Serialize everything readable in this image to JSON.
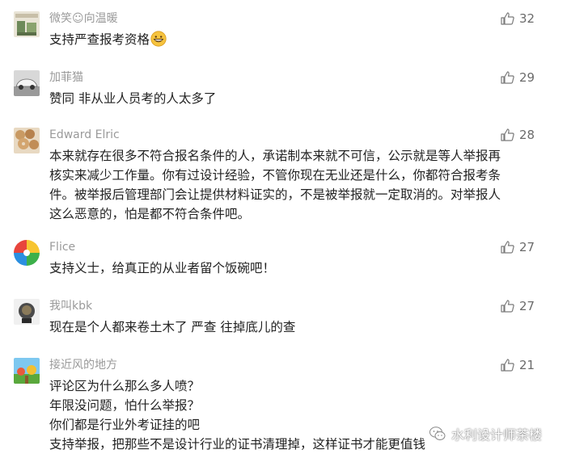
{
  "comments": [
    {
      "username": "微笑☺向温暖",
      "likes": "32",
      "lines": [
        "支持严查报考资格"
      ],
      "emoji": "grinning-face-icon"
    },
    {
      "username": "加菲猫",
      "likes": "29",
      "lines": [
        "赞同 非从业人员考的人太多了"
      ]
    },
    {
      "username": "Edward Elric",
      "likes": "28",
      "lines": [
        "本来就存在很多不符合报名条件的人，承诺制本来就不可信，公示就是等人举报再",
        "核实来减少工作量。你有过设计经验，不管你现在无业还是什么，你都符合报考条",
        "件。被举报后管理部门会让提供材料证实的，不是被举报就一定取消的。对举报人",
        "这么恶意的，怕是都不符合条件吧。"
      ]
    },
    {
      "username": "Flice",
      "likes": "27",
      "lines": [
        "支持义士，给真正的从业者留个饭碗吧！"
      ]
    },
    {
      "username": "我叫kbk",
      "likes": "27",
      "lines": [
        "现在是个人都来卷土木了 严查 往掉底儿的查"
      ]
    },
    {
      "username": "接近风的地方",
      "likes": "21",
      "lines": [
        "评论区为什么那么多人喷？",
        "年限没问题，怕什么举报？",
        "你们都是行业外考证挂的吧",
        "支持举报，把那些不是设计行业的证书清理掉，这样证书才能更值钱"
      ]
    }
  ],
  "watermark": {
    "text": "水利设计师茶楼",
    "icon": "wechat-icon"
  },
  "colors": {
    "username": "#9a9a9a",
    "text": "#222222",
    "like": "#6b6b6b"
  }
}
